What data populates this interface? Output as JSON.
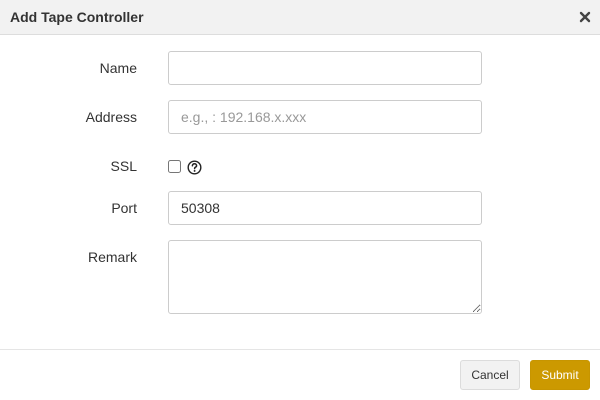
{
  "dialog": {
    "title": "Add Tape Controller",
    "close_icon": "close-icon"
  },
  "form": {
    "name": {
      "label": "Name",
      "value": "",
      "placeholder": ""
    },
    "address": {
      "label": "Address",
      "value": "",
      "placeholder": "e.g., : 192.168.x.xxx"
    },
    "ssl": {
      "label": "SSL",
      "checked": false,
      "help_icon": "question-circle-icon"
    },
    "port": {
      "label": "Port",
      "value": "50308",
      "placeholder": ""
    },
    "remark": {
      "label": "Remark",
      "value": "",
      "placeholder": ""
    }
  },
  "footer": {
    "cancel_label": "Cancel",
    "submit_label": "Submit"
  },
  "colors": {
    "header_bg": "#f2f2f2",
    "submit_bg": "#cc9900",
    "cancel_bg": "#f2f2f2",
    "text": "#333333",
    "placeholder": "#999999"
  }
}
